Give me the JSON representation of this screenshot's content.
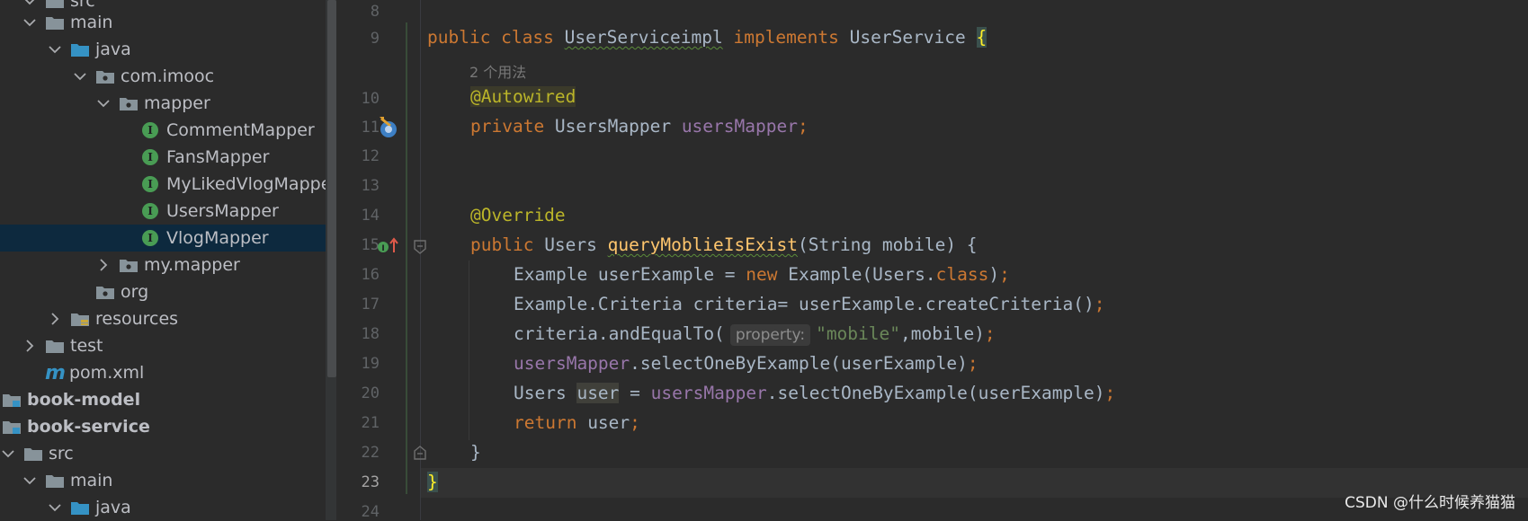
{
  "project_tree": {
    "items": [
      {
        "label": "src",
        "expanded": true,
        "icon": "folder-icon",
        "bold": false,
        "selected": false
      },
      {
        "label": "main",
        "expanded": true,
        "icon": "folder-icon",
        "bold": false,
        "selected": false
      },
      {
        "label": "java",
        "expanded": true,
        "icon": "source-folder-icon",
        "bold": false,
        "selected": false
      },
      {
        "label": "com.imooc",
        "expanded": true,
        "icon": "package-icon",
        "bold": false,
        "selected": false
      },
      {
        "label": "mapper",
        "expanded": true,
        "icon": "package-icon",
        "bold": false,
        "selected": false
      },
      {
        "label": "CommentMapper",
        "expanded": null,
        "icon": "interface-icon",
        "bold": false,
        "selected": false
      },
      {
        "label": "FansMapper",
        "expanded": null,
        "icon": "interface-icon",
        "bold": false,
        "selected": false
      },
      {
        "label": "MyLikedVlogMapper",
        "expanded": null,
        "icon": "interface-icon",
        "bold": false,
        "selected": false
      },
      {
        "label": "UsersMapper",
        "expanded": null,
        "icon": "interface-icon",
        "bold": false,
        "selected": false
      },
      {
        "label": "VlogMapper",
        "expanded": null,
        "icon": "interface-icon",
        "bold": false,
        "selected": true
      },
      {
        "label": "my.mapper",
        "expanded": false,
        "icon": "package-icon",
        "bold": false,
        "selected": false
      },
      {
        "label": "org",
        "expanded": null,
        "icon": "package-icon",
        "bold": false,
        "selected": false
      },
      {
        "label": "resources",
        "expanded": false,
        "icon": "resources-folder-icon",
        "bold": false,
        "selected": false
      },
      {
        "label": "test",
        "expanded": false,
        "icon": "folder-icon",
        "bold": false,
        "selected": false
      },
      {
        "label": "pom.xml",
        "expanded": null,
        "icon": "maven-icon",
        "bold": false,
        "selected": false
      },
      {
        "label": "book-model",
        "expanded": null,
        "icon": "module-icon",
        "bold": true,
        "selected": false
      },
      {
        "label": "book-service",
        "expanded": null,
        "icon": "module-icon",
        "bold": true,
        "selected": false
      },
      {
        "label": "src",
        "expanded": true,
        "icon": "folder-icon",
        "bold": false,
        "selected": false
      },
      {
        "label": "main",
        "expanded": true,
        "icon": "folder-icon",
        "bold": false,
        "selected": false
      },
      {
        "label": "java",
        "expanded": true,
        "icon": "source-folder-icon",
        "bold": false,
        "selected": false
      }
    ]
  },
  "editor": {
    "line_numbers": [
      "8",
      "9",
      "10",
      "11",
      "12",
      "13",
      "14",
      "15",
      "16",
      "17",
      "18",
      "19",
      "20",
      "21",
      "22",
      "23",
      "24"
    ],
    "current_line": "23",
    "usage_hint": "2 个用法",
    "param_hint": "property:",
    "code": {
      "l9": {
        "kw1": "public class ",
        "cls": "UserServiceimpl",
        "kw2": " implements ",
        "iface": "UserService ",
        "brace": "{"
      },
      "l10": {
        "ann": "@Autowired"
      },
      "l11": {
        "kw": "private ",
        "type": "UsersMapper ",
        "field": "usersMapper",
        "semi": ";"
      },
      "l14": {
        "ann": "@Override"
      },
      "l15": {
        "kw": "public ",
        "type": "Users ",
        "method": "queryMoblieIsExist",
        "rest": "(String mobile) {"
      },
      "l16": {
        "a": "Example userExample = ",
        "kw": "new",
        "b": " Example(Users.",
        "kw2": "class",
        "c": ")",
        "semi": ";"
      },
      "l17": {
        "a": "Example.Criteria criteria= userExample.createCriteria()",
        "semi": ";"
      },
      "l18": {
        "a": "criteria.andEqualTo(",
        "str": "\"mobile\"",
        "b": ",mobile)",
        "semi": ";"
      },
      "l19": {
        "field": "usersMapper",
        "a": ".selectOneByExample(userExample)",
        "semi": ";"
      },
      "l20": {
        "a": "Users ",
        "var": "user",
        "b": " = ",
        "field": "usersMapper",
        "c": ".selectOneByExample(userExample)",
        "semi": ";"
      },
      "l21": {
        "kw": "return ",
        "a": "user",
        "semi": ";"
      },
      "l22": {
        "a": "}"
      },
      "l23": {
        "brace": "}"
      }
    }
  },
  "watermark": "CSDN @什么时候养猫猫",
  "colors": {
    "background": "#2b2b2b",
    "keyword": "#cc7832",
    "annotation": "#bbb529",
    "field": "#9876aa",
    "method": "#ffc66d",
    "string": "#6a8759",
    "text": "#a9b7c6",
    "selection": "#0d293e"
  }
}
